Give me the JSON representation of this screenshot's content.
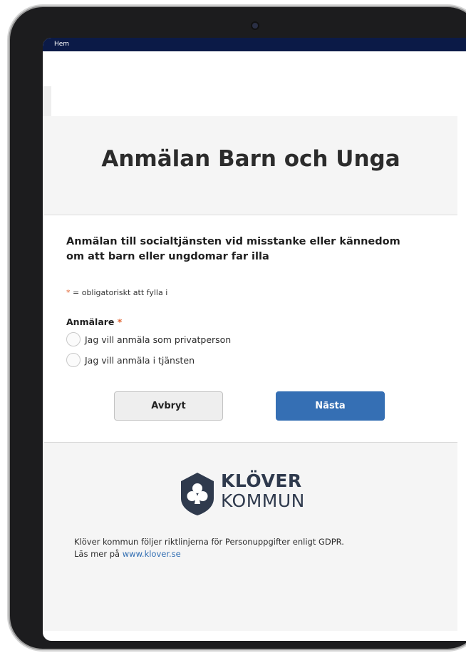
{
  "topbar": {
    "home_label": "Hem"
  },
  "hero": {
    "title": "Anmälan Barn och Unga"
  },
  "form": {
    "intro_line1": "Anmälan till socialtjänsten vid misstanke eller kännedom",
    "intro_line2": "om att barn eller ungdomar far illa",
    "required_star": "*",
    "required_text": " = obligatoriskt att fylla i",
    "reporter_label": "Anmälare",
    "options": [
      {
        "label": "Jag vill anmäla som privatperson",
        "selected": false
      },
      {
        "label": "Jag vill anmäla i tjänsten",
        "selected": false
      }
    ],
    "cancel_label": "Avbryt",
    "next_label": "Nästa"
  },
  "footer": {
    "logo_line1": "KLÖVER",
    "logo_line2": "KOMMUN",
    "gdpr_text": "Klöver kommun följer riktlinjerna för Personuppgifter enligt GDPR.",
    "read_more_prefix": "Läs mer på ",
    "link_text": "www.klover.se"
  },
  "colors": {
    "topbar": "#0b1a47",
    "accent": "#356fb4",
    "required": "#e0622f",
    "logo": "#2f3a4d"
  }
}
